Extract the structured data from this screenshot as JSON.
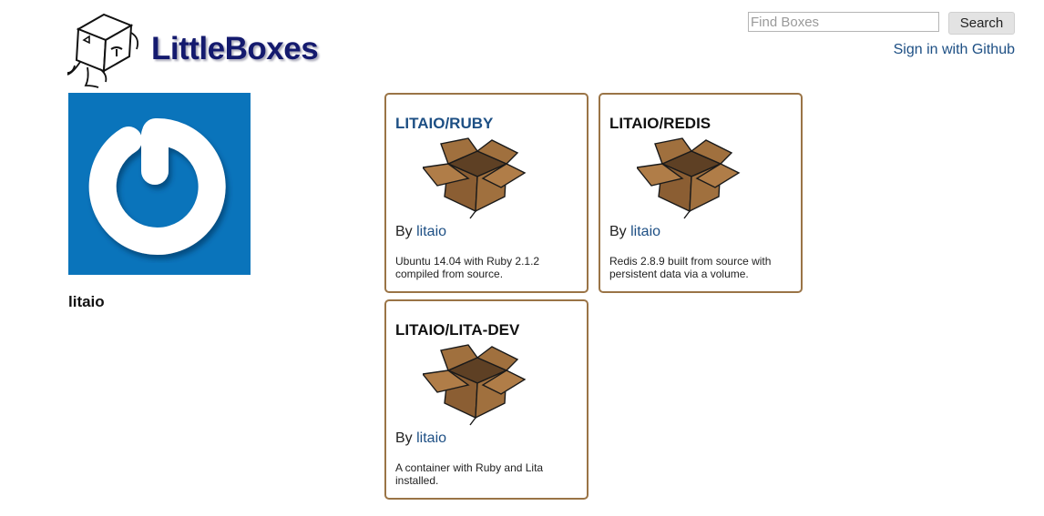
{
  "header": {
    "brand": "LittleBoxes",
    "search_placeholder": "Find Boxes",
    "search_button": "Search",
    "signin_link": "Sign in with Github"
  },
  "profile": {
    "username": "litaio",
    "avatar_icon": "power-icon",
    "avatar_color": "#0a74bb"
  },
  "boxes": [
    {
      "title": "LITAIO/RUBY",
      "by_label": "By",
      "author": "litaio",
      "description": "Ubuntu 14.04 with Ruby 2.1.2 compiled from source.",
      "icon": "cardboard-box-icon"
    },
    {
      "title": "LITAIO/REDIS",
      "by_label": "By",
      "author": "litaio",
      "description": "Redis 2.8.9 built from source with persistent data via a volume.",
      "icon": "cardboard-box-icon"
    },
    {
      "title": "LITAIO/LITA-DEV",
      "by_label": "By",
      "author": "litaio",
      "description": "A container with Ruby and Lita installed.",
      "icon": "cardboard-box-icon"
    }
  ],
  "colors": {
    "brand_text": "#141a6e",
    "link": "#1d4f84",
    "card_border": "#9a7446",
    "box_brown": "#a0703e"
  }
}
